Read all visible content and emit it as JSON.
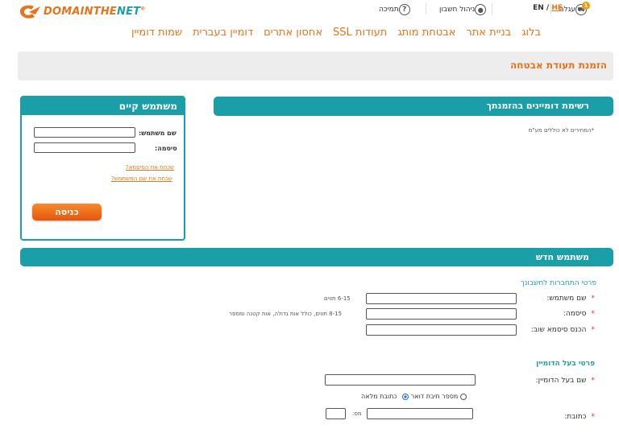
{
  "brand": {
    "name_part1": "DOMAIN",
    "name_part2": "THE",
    "name_part3": "NET",
    "reg": "®",
    "accent": "#e8731a",
    "teal": "#1a9fa8"
  },
  "topbar": {
    "cart_label": "עגלה",
    "cart_count": "1",
    "lang_en": "EN",
    "lang_sep": " / ",
    "lang_he": "HE",
    "account_label": "ניהול חשבון",
    "support_label": "תמיכה",
    "icons": {
      "cart": "cart-icon",
      "account": "user-icon",
      "support": "question-icon"
    }
  },
  "mainnav": [
    "שמות דומיין",
    "דומיין בעברית",
    "אחסון אתרים",
    "תעודות SSL",
    "אבטחת מותג",
    "בניית אתר",
    "בלוג"
  ],
  "page_title": "הזמנת תעודת אבטחה",
  "domain_list": {
    "title": "רשימת דומיינים בהזמנתך",
    "note": "*המחירים לא כוללים מע\"מ"
  },
  "login": {
    "title": "משתמש קיים",
    "username_label": "שם משתמש:",
    "password_label": "סיסמה:",
    "forgot_password": "שכחת את הסיסמא?",
    "forgot_username": "שכחת את שם המשתמש?",
    "submit": "כניסה"
  },
  "new_user": {
    "title": "משתמש חדש",
    "account_section": "פרטי התחברות לחשבונך",
    "username_label": "שם משתמש:",
    "username_hint": "6-15 תווים",
    "password_label": "סיסמה:",
    "password_hint": "8-15 תווים, כולל אות גדולה, אות קטנה ומספר",
    "confirm_label": "הכנס סיסמא שוב:",
    "owner_section": "פרטי בעל הדומיין",
    "owner_label": "שם בעל הדומיין:",
    "address_option_full": "כתובת מלאה",
    "address_option_pobox": "מספר תיבת דואר",
    "address_label": "כתובת:",
    "number_label": "מס:"
  }
}
